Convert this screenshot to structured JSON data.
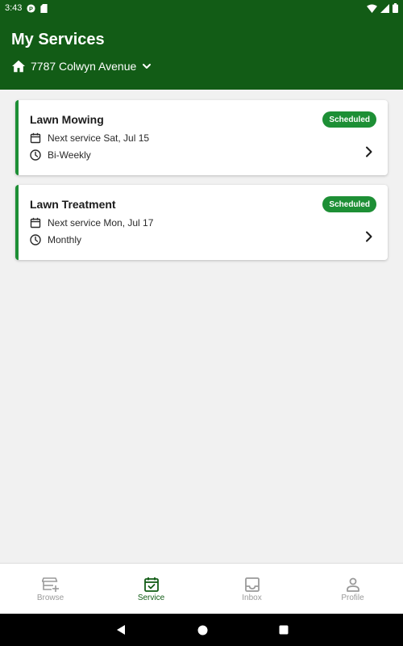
{
  "status_bar": {
    "time": "3:43"
  },
  "header": {
    "title": "My Services",
    "address": "7787 Colwyn Avenue"
  },
  "services": [
    {
      "name": "Lawn Mowing",
      "status": "Scheduled",
      "next_service": "Next service Sat, Jul 15",
      "frequency": "Bi-Weekly"
    },
    {
      "name": "Lawn Treatment",
      "status": "Scheduled",
      "next_service": "Next service Mon, Jul 17",
      "frequency": "Monthly"
    }
  ],
  "bottom_nav": {
    "items": [
      {
        "label": "Browse",
        "icon": "store-icon"
      },
      {
        "label": "Service",
        "icon": "calendar-check-icon"
      },
      {
        "label": "Inbox",
        "icon": "inbox-icon"
      },
      {
        "label": "Profile",
        "icon": "person-icon"
      }
    ],
    "active": "Service"
  },
  "colors": {
    "header": "#125c16",
    "accent": "#1d8f35",
    "background": "#f1f1f1"
  }
}
